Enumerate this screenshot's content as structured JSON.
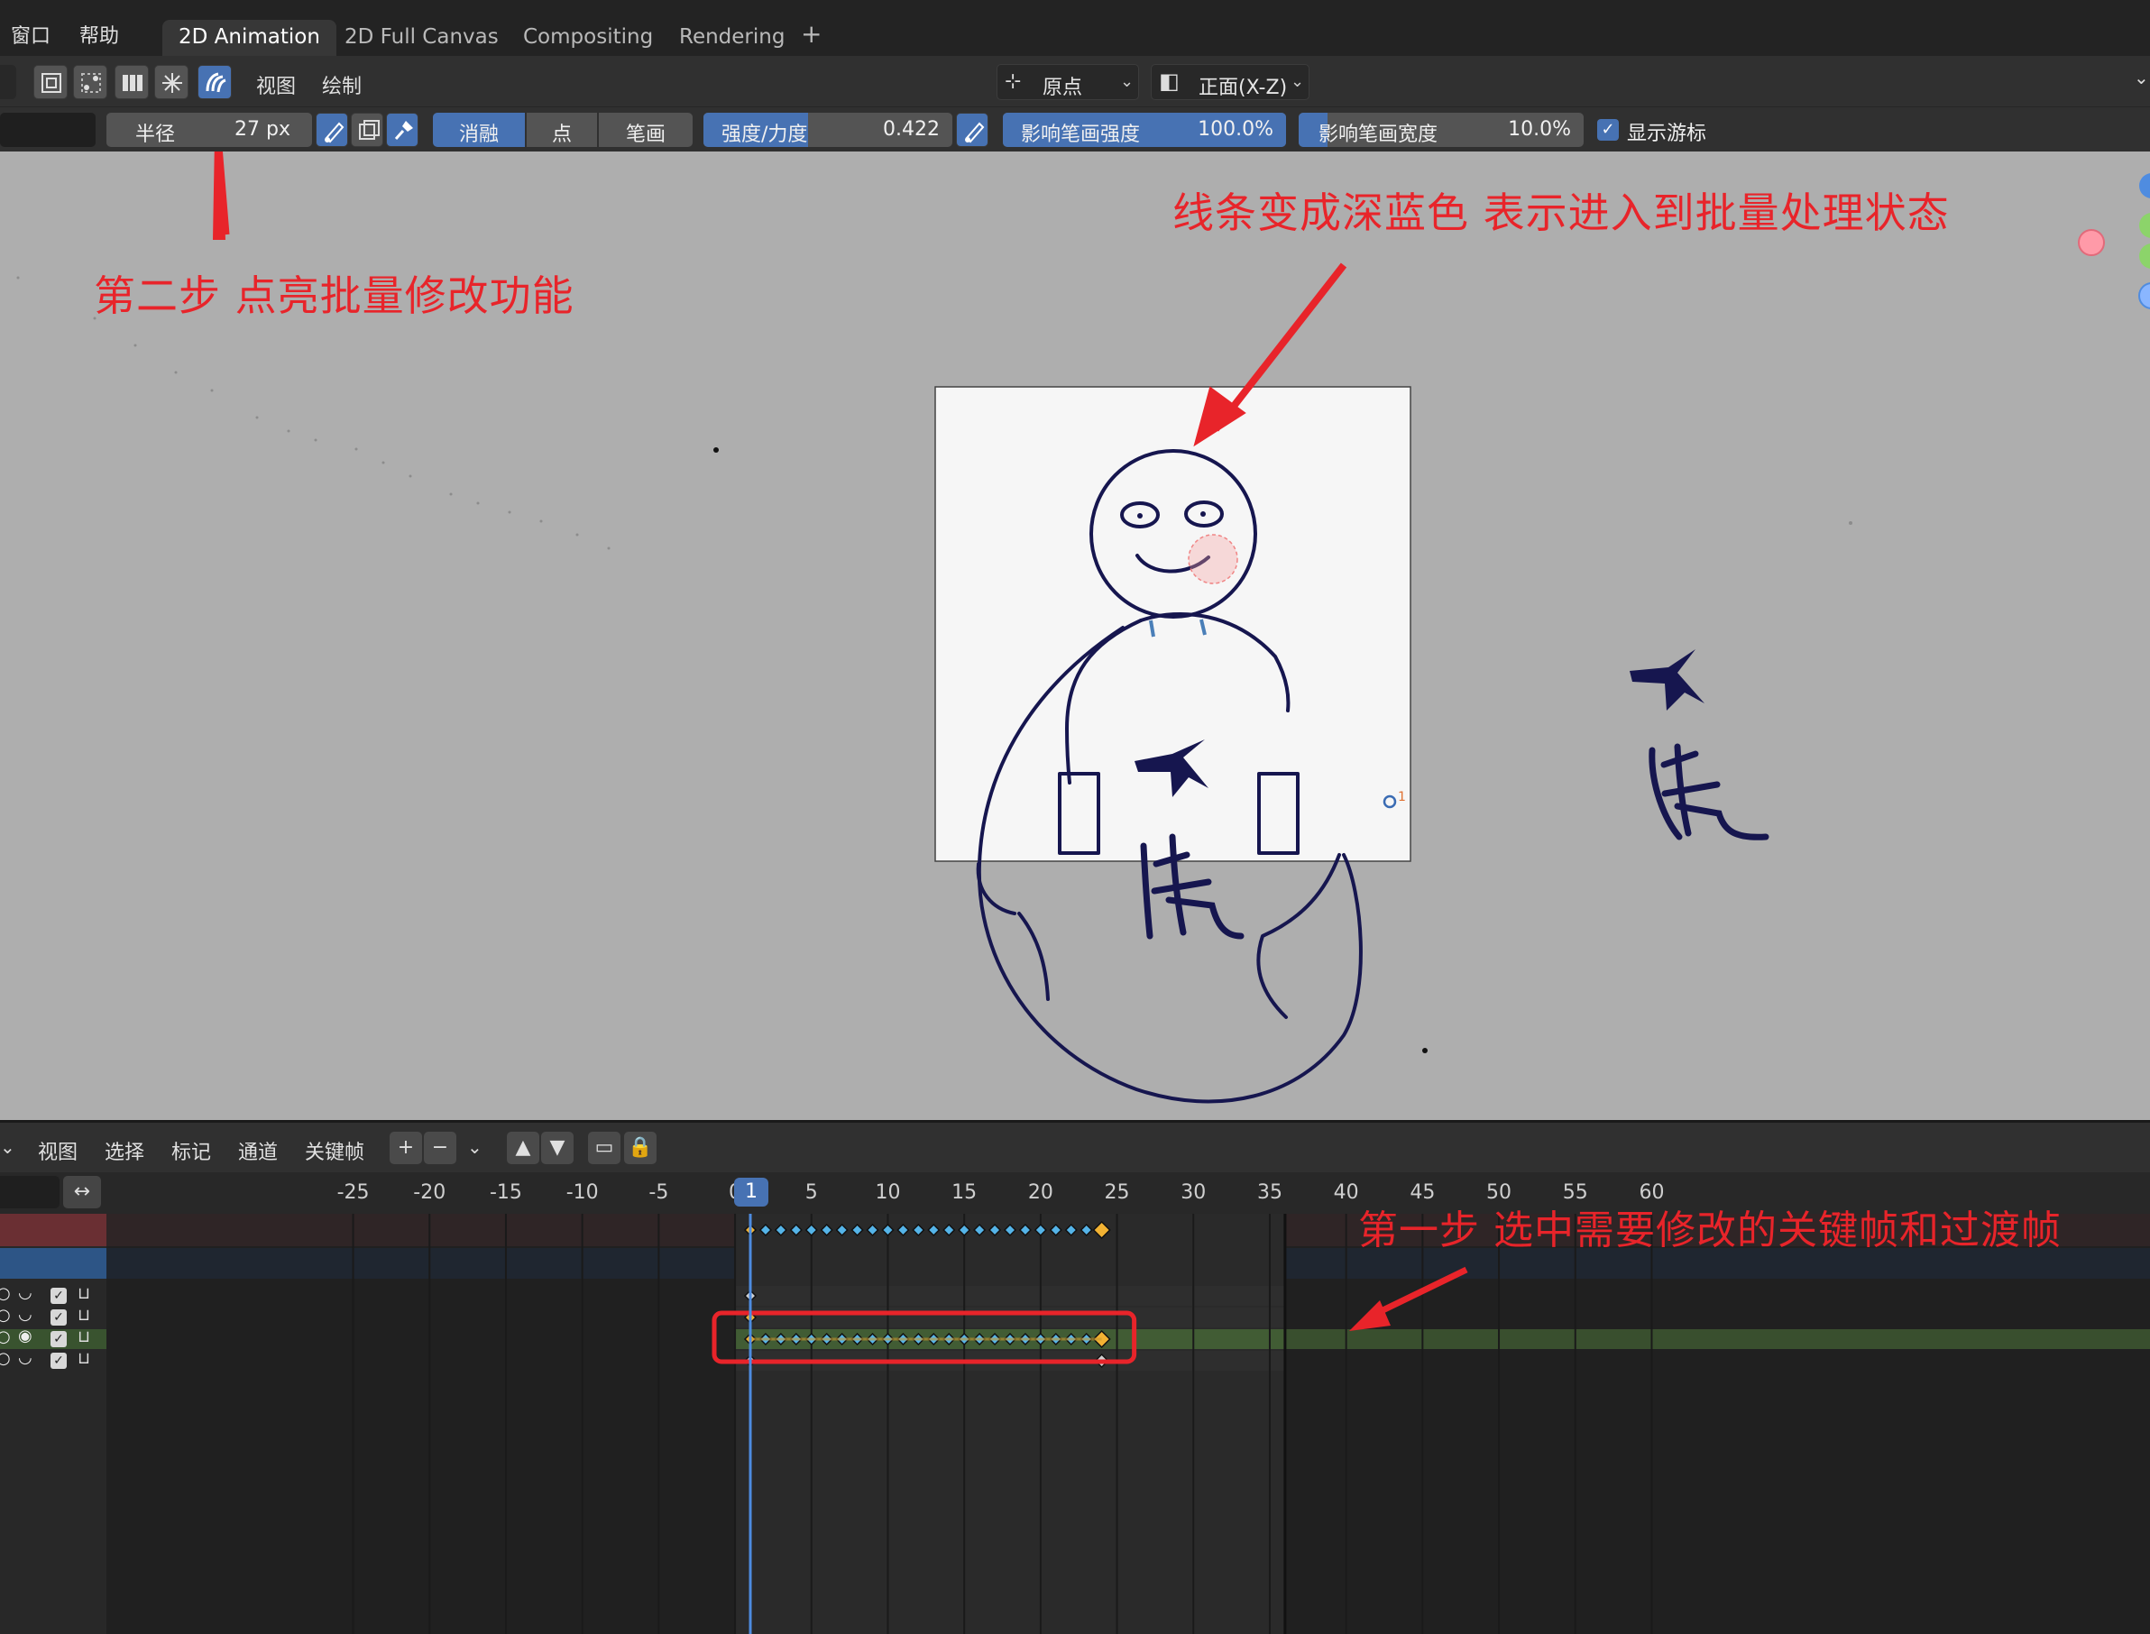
{
  "menu": {
    "window": "窗口",
    "help": "帮助"
  },
  "workspaces": [
    "2D Animation",
    "2D Full Canvas",
    "Compositing",
    "Rendering"
  ],
  "workspace_add": "+",
  "header": {
    "view": "视图",
    "draw": "绘制",
    "origin_label": "原点",
    "view_label": "正面(X-Z)",
    "chevron": "⌄"
  },
  "tool_settings": {
    "radius_label": "半径",
    "radius_value": "27 px",
    "mode_buttons": [
      "消融",
      "点",
      "笔画"
    ],
    "active_mode": "消融",
    "strength_label": "强度/力度",
    "strength_value": "0.422",
    "strength_fraction": 0.422,
    "affect_strength_label": "影响笔画强度",
    "affect_strength_value": "100.0%",
    "affect_strength_fraction": 1.0,
    "affect_width_label": "影响笔画宽度",
    "affect_width_value": "10.0%",
    "affect_width_fraction": 0.1,
    "show_cursor_label": "显示游标",
    "show_cursor_checked": true
  },
  "annotations": {
    "step_two": "第二步 点亮批量修改功能",
    "line_blue": "线条变成深蓝色 表示进入到批量处理状态",
    "step_one": "第一步 选中需要修改的关键帧和过渡帧"
  },
  "canvas": {
    "drawing_color": "#16164f",
    "layer_marker": "1"
  },
  "timeline": {
    "menu": [
      "视图",
      "选择",
      "标记",
      "通道",
      "关键帧"
    ],
    "current_frame": "1",
    "ruler_labels": [
      "-25",
      "-20",
      "-15",
      "-10",
      "-5",
      "0",
      "5",
      "10",
      "15",
      "20",
      "25",
      "30",
      "35",
      "40",
      "45",
      "50",
      "55",
      "60"
    ],
    "selected_keyframe_color": "#f2b233",
    "inbetween_color": "#55b4e8",
    "annotation_box_color": "#e8242a"
  }
}
